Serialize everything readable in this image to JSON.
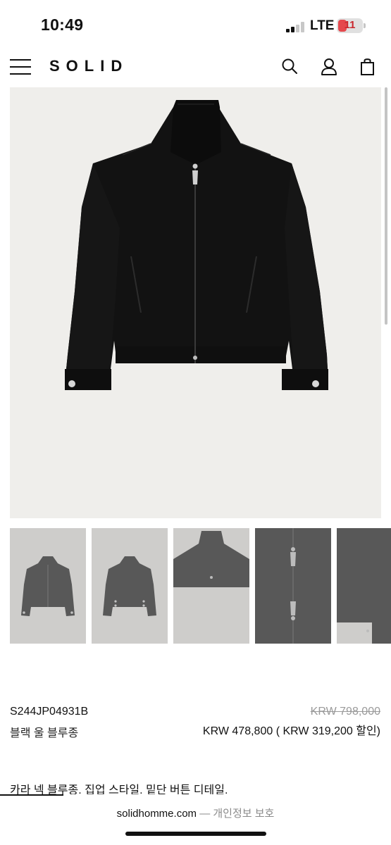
{
  "status_bar": {
    "time": "10:49",
    "network": "LTE",
    "battery_level": "11",
    "battery_color": "#e5484d"
  },
  "header": {
    "logo": "SOLID",
    "icons": [
      "menu-icon",
      "search-icon",
      "account-icon",
      "shopping-bag-icon"
    ]
  },
  "gallery": {
    "main_image": "black-wool-blouson-front",
    "thumbnails": [
      {
        "name": "front-view"
      },
      {
        "name": "back-view"
      },
      {
        "name": "collar-detail"
      },
      {
        "name": "zipper-detail"
      },
      {
        "name": "cuff-detail"
      }
    ]
  },
  "product": {
    "sku": "S244JP04931B",
    "name": "블랙 울 블루종",
    "original_price": "KRW 798,000",
    "sale_price": "KRW 478,800 ( KRW 319,200 할인)",
    "description": "카라 넥 블루종. 집업 스타일. 밑단 버튼 디테일."
  },
  "browser": {
    "domain": "solidhomme.com",
    "separator": " — ",
    "privacy_label": "개인정보 보호"
  }
}
